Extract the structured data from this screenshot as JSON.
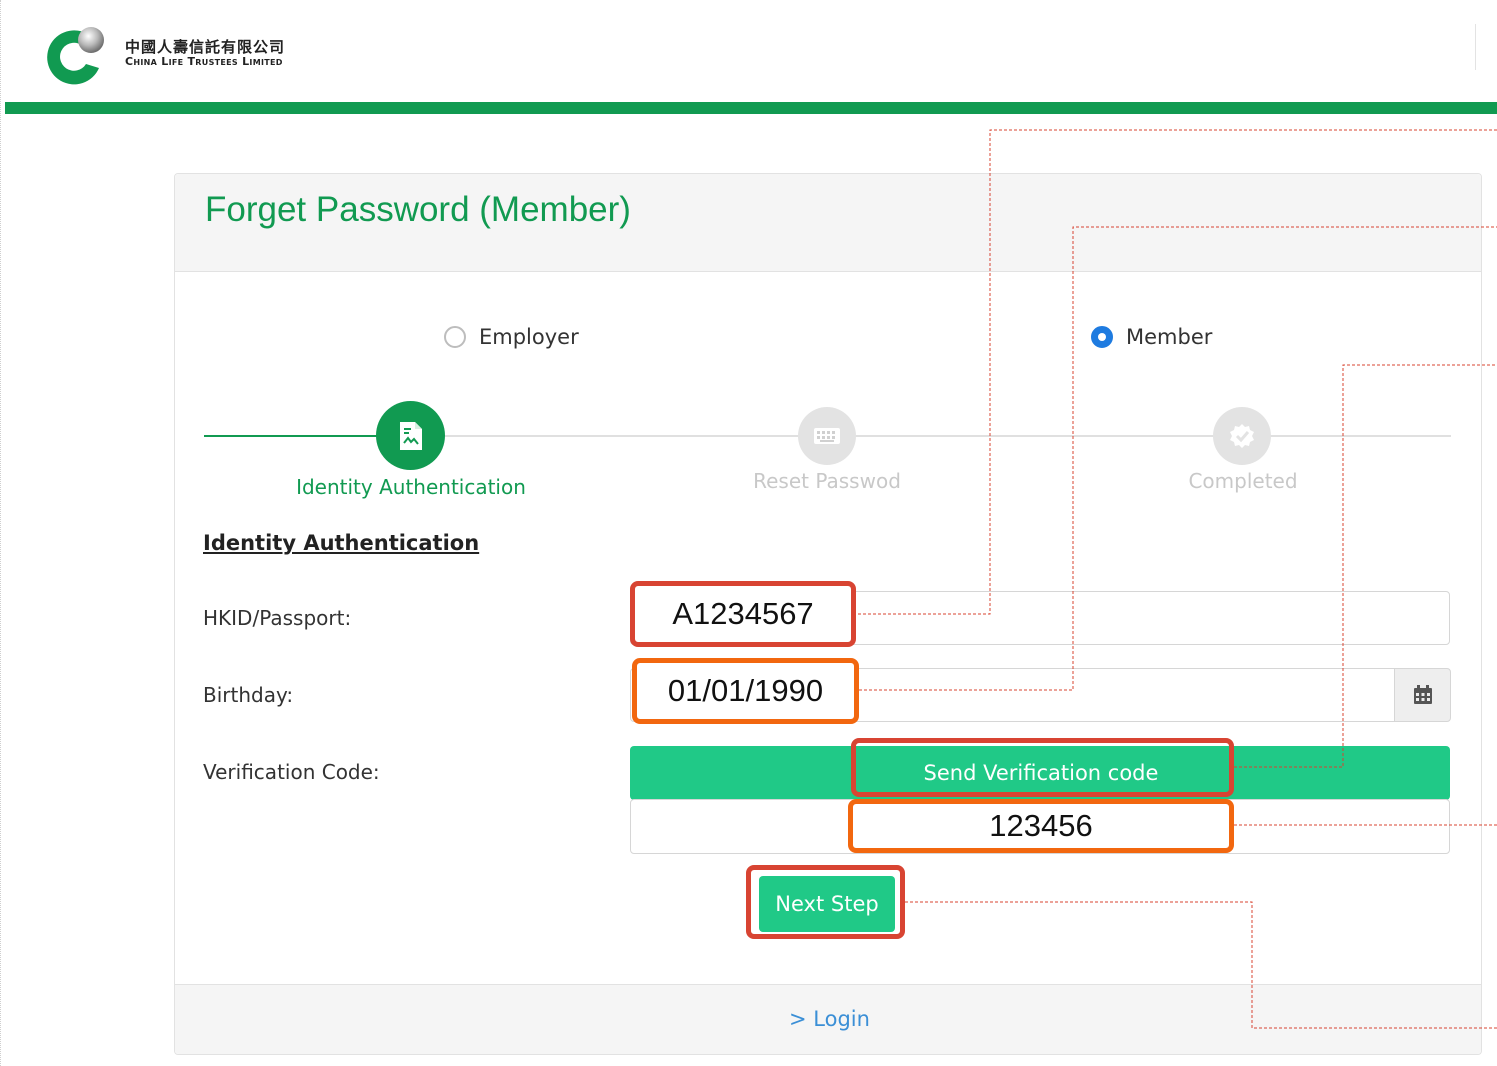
{
  "header": {
    "logo_cn": "中國人壽信託有限公司",
    "logo_en": "China Life Trustees Limited"
  },
  "card": {
    "title": "Forget Password (Member)",
    "login_link": "> Login"
  },
  "user_type": {
    "options": [
      {
        "label": "Employer",
        "selected": false
      },
      {
        "label": "Member",
        "selected": true
      }
    ]
  },
  "stepper": {
    "steps": [
      {
        "label": "Identity Authentication",
        "status": "active",
        "icon": "document-icon"
      },
      {
        "label": "Reset Passwod",
        "status": "pending",
        "icon": "keyboard-icon"
      },
      {
        "label": "Completed",
        "status": "pending",
        "icon": "check-icon"
      }
    ]
  },
  "form": {
    "section_heading": "Identity Authentication",
    "hkid_label": "HKID/Passport:",
    "birthday_label": "Birthday:",
    "verification_label": "Verification Code:",
    "send_code_label": "Send Verification code",
    "next_label": "Next Step"
  },
  "annotations": {
    "hkid_value": "A1234567",
    "birthday_value": "01/01/1990",
    "code_value": "123456"
  },
  "colors": {
    "brand_green": "#119a51",
    "button_green": "#20c987",
    "callout_red": "#d84432",
    "callout_orange": "#f2670f",
    "link_blue": "#3b8fd6",
    "radio_blue": "#1e7be0"
  }
}
